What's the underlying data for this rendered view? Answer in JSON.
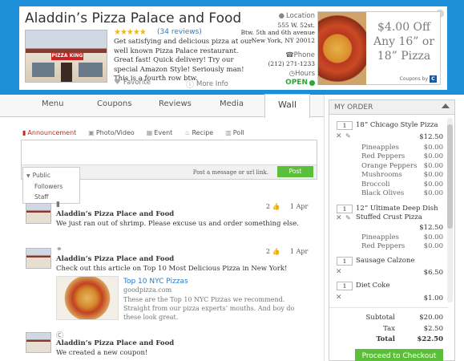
{
  "header": {
    "title": "Aladdin’s Pizza Palace and Food",
    "stars": "★★★★★",
    "reviews": "(34 reviews)",
    "description": "Get satisfying and delicious pizza at our well known Pizza Palace restaurant. Great fast! Quick delivery! Try our special Amazon Style! Seriously man! This is a fourth row btw.",
    "favorite": "Favorite",
    "more_info": "More Info",
    "storefront_sign": "PIZZA KING",
    "location_label": "Location",
    "address": [
      "555 W. 52st.",
      "Btw. 5th and 6th avenue",
      "New York, NY 20012"
    ],
    "phone_label": "Phone",
    "phone": "(212) 271-1233",
    "hours_label": "Hours",
    "hours_status": "OPEN",
    "coupon": {
      "offer_lines": [
        "$4.00 Off",
        "Any 16” or",
        "18” Pizza"
      ],
      "by": "Coupons by"
    }
  },
  "tabs": [
    "Menu",
    "Coupons",
    "Reviews",
    "Media",
    "Wall"
  ],
  "composer": {
    "types": [
      "Announcement",
      "Photo/Video",
      "Event",
      "Recipe",
      "Poll"
    ],
    "hint": "Post a message or url link.",
    "post_label": "Post",
    "audience": [
      "Public",
      "Followers",
      "Staff"
    ]
  },
  "feed": [
    {
      "name": "Aladdin’s Pizza Place and Food",
      "text": "We just ran out of shrimp. Please excuse us and order something else.",
      "likes": "2",
      "date": "1 Apr"
    },
    {
      "name": "Aladdin’s Pizza Place and Food",
      "text": "Check out this article on Top 10 Most Delicious Pizza in New York!",
      "likes": "2",
      "date": "1 Apr",
      "link": {
        "title": "Top 10 NYC Pizzas",
        "domain": "goodpizza.com",
        "desc": "These are the Top 10 NYC Pizzas we recommend. Straight from our pizza experts’ mouths. And boy do these look great."
      }
    },
    {
      "name": "Aladdin’s Pizza Place and Food",
      "text": "We created a new coupon!",
      "likes": "2",
      "date": "1 Apr"
    }
  ],
  "order": {
    "title": "MY ORDER",
    "items": [
      {
        "qty": "1",
        "name": "18” Chicago Style Pizza",
        "price": "$12.50",
        "toppings": [
          {
            "name": "Pineapples",
            "price": "$0.00"
          },
          {
            "name": "Red Peppers",
            "price": "$0.00"
          },
          {
            "name": "Orange Peppers",
            "price": "$0.00"
          },
          {
            "name": "Mushrooms",
            "price": "$0.00"
          },
          {
            "name": "Broccoli",
            "price": "$0.00"
          },
          {
            "name": "Black Olives",
            "price": "$0.00"
          }
        ]
      },
      {
        "qty": "1",
        "name": "12” Ultimate Deep Dish",
        "name2": "Stuffed Crust Pizza",
        "price": "$12.50",
        "toppings": [
          {
            "name": "Pineapples",
            "price": "$0.00"
          },
          {
            "name": "Red Peppers",
            "price": "$0.00"
          }
        ]
      },
      {
        "qty": "1",
        "name": "Sausage Calzone",
        "price": "$6.50"
      },
      {
        "qty": "1",
        "name": "Diet Coke",
        "price": "$1.00"
      }
    ],
    "subtotal_label": "Subtotal",
    "subtotal": "$20.00",
    "tax_label": "Tax",
    "tax": "$2.50",
    "total_label": "Total",
    "total": "$22.50",
    "checkout": "Proceed to Checkout"
  }
}
